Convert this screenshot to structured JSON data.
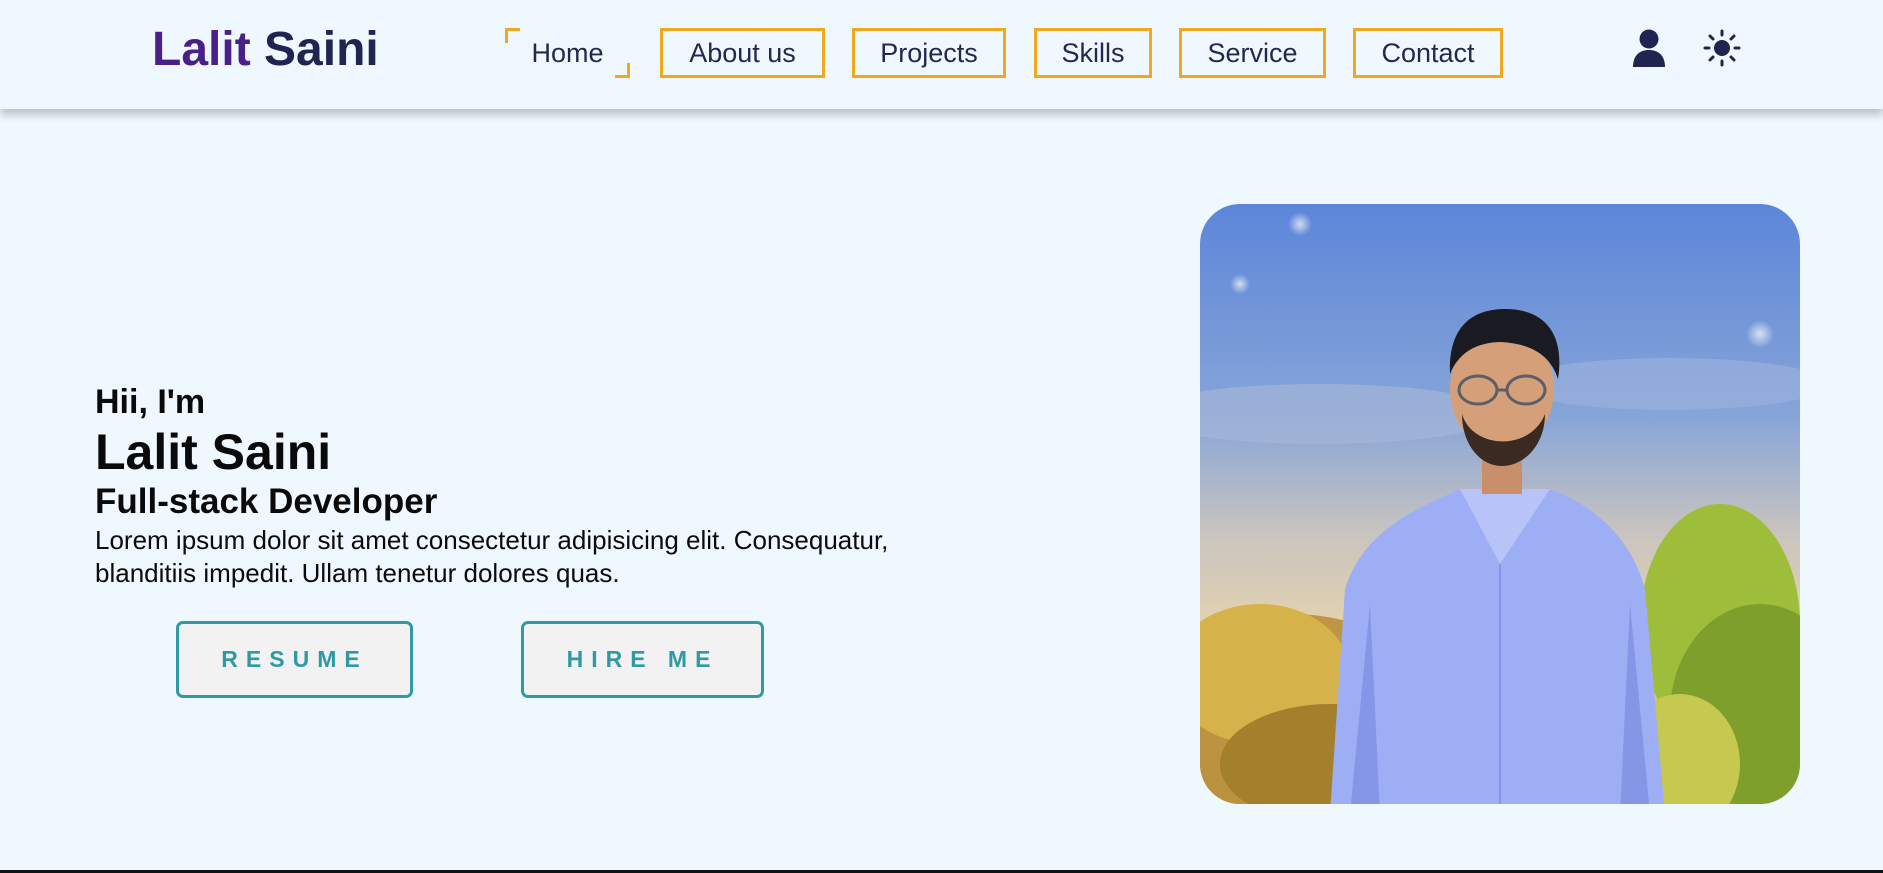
{
  "nav": {
    "logo_first": "Lalit",
    "logo_last": "Saini",
    "items": [
      {
        "label": "Home",
        "active": true
      },
      {
        "label": "About us"
      },
      {
        "label": "Projects"
      },
      {
        "label": "Skills"
      },
      {
        "label": "Service"
      },
      {
        "label": "Contact"
      }
    ],
    "icons": [
      "user-icon",
      "sun-icon"
    ]
  },
  "hero": {
    "greeting": "Hii, I'm",
    "name": "Lalit Saini",
    "role": "Full-stack Developer",
    "description": "Lorem ipsum dolor sit amet consectetur adipisicing elit. Consequatur, blanditiis impedit. Ullam tenetur dolores quas.",
    "buttons": {
      "resume": "RESUME",
      "hire": "HIRE ME"
    }
  },
  "colors": {
    "background": "#f0f8ff",
    "logo_first": "#4a2088",
    "logo_last": "#1f2451",
    "nav_border": "#f0a81e",
    "button_accent": "#2f9aa6"
  }
}
